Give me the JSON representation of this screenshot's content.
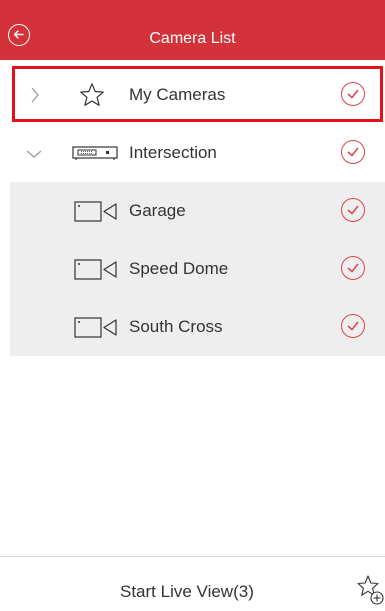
{
  "header": {
    "title": "Camera List",
    "back_icon": "back-arrow-circle-icon",
    "background_color": "#d4323b"
  },
  "rows": [
    {
      "label": "My Cameras",
      "expand_icon": "chevron-right-icon",
      "type_icon": "star-icon",
      "checked": true,
      "highlighted": true
    },
    {
      "label": "Intersection",
      "expand_icon": "chevron-down-icon",
      "type_icon": "dvr-device-icon",
      "checked": true
    },
    {
      "label": "Garage",
      "type_icon": "camera-icon",
      "checked": true
    },
    {
      "label": "Speed Dome",
      "type_icon": "camera-icon",
      "checked": true
    },
    {
      "label": "South Cross",
      "type_icon": "camera-icon",
      "checked": true
    }
  ],
  "footer": {
    "start_label": "Start Live View(3)",
    "favorite_icon": "star-plus-icon"
  },
  "colors": {
    "accent": "#e0434c",
    "highlight_border": "#e5101a",
    "group_background": "#eeeeee"
  }
}
